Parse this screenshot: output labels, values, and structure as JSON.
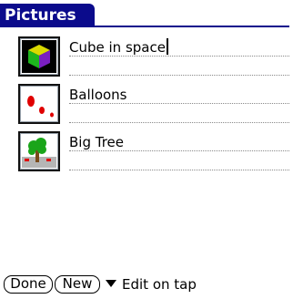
{
  "app": {
    "title": "Pictures"
  },
  "records": [
    {
      "label": "Cube in space",
      "thumb_icon": "cube-in-space-thumbnail",
      "editing": true
    },
    {
      "label": "Balloons",
      "thumb_icon": "balloons-thumbnail",
      "editing": false
    },
    {
      "label": "Big Tree",
      "thumb_icon": "big-tree-thumbnail",
      "editing": false
    }
  ],
  "footer": {
    "done_label": "Done",
    "new_label": "New",
    "menu_label": "Edit on tap"
  },
  "colors": {
    "title_bar": "#0b0b8c"
  }
}
